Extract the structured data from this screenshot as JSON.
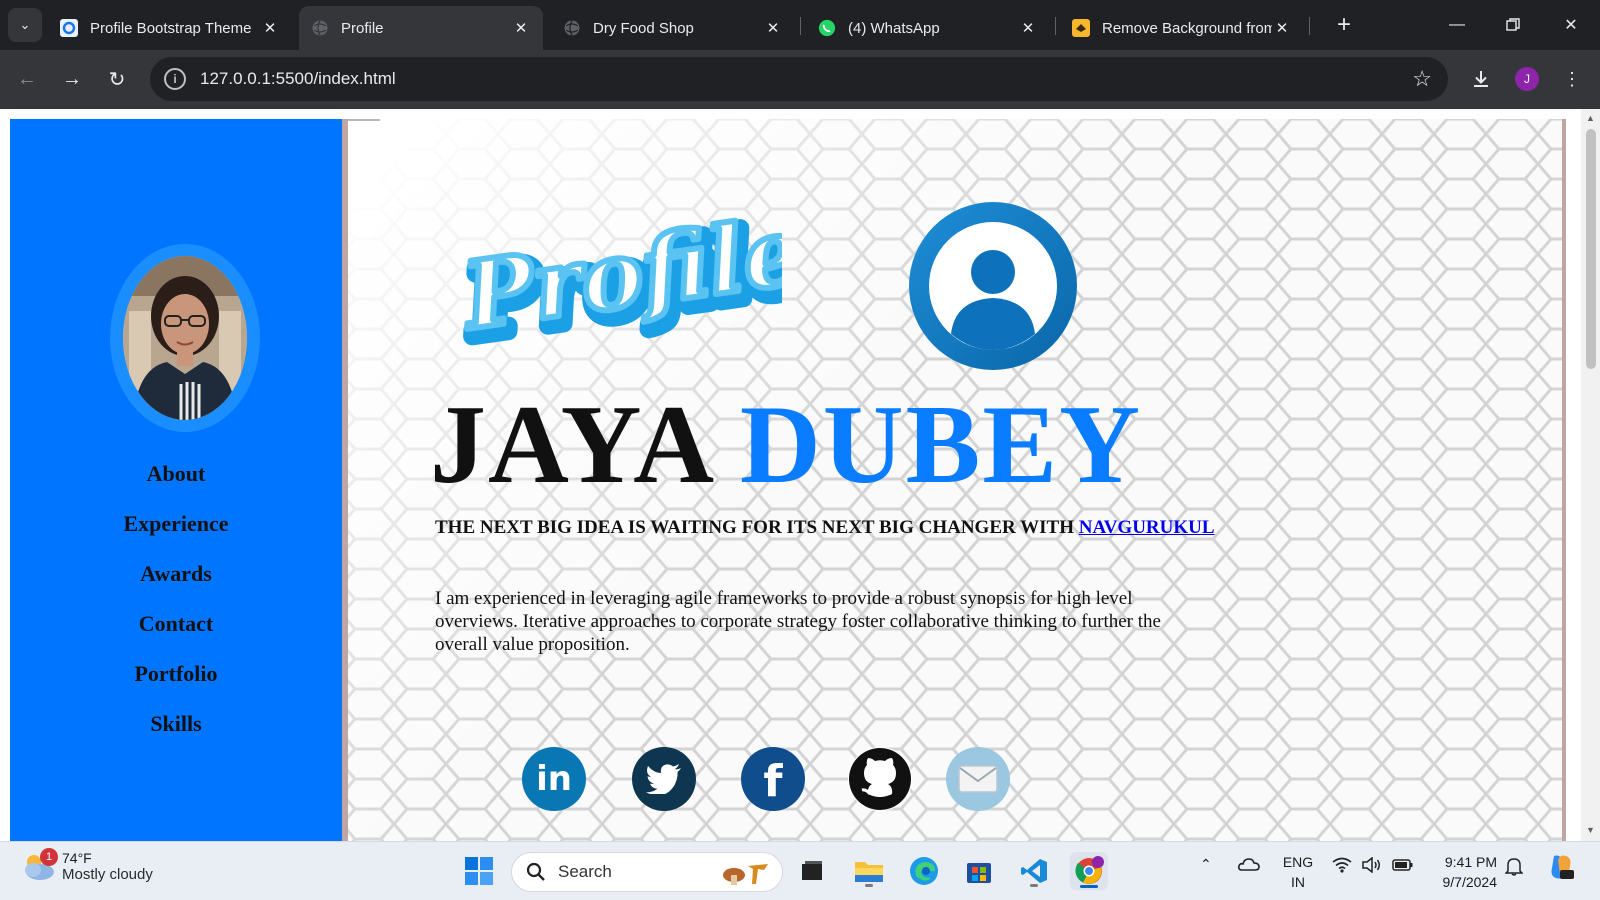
{
  "browser": {
    "tabs": [
      {
        "title": "Profile Bootstrap Theme",
        "active": false
      },
      {
        "title": "Profile",
        "active": true
      },
      {
        "title": "Dry Food Shop",
        "active": false
      },
      {
        "title": "(4) WhatsApp",
        "active": false
      },
      {
        "title": "Remove Background from",
        "active": false
      }
    ],
    "url": "127.0.0.1:5500/index.html",
    "profile_initial": "J"
  },
  "page": {
    "sidebar": {
      "nav": [
        "About",
        "Experience",
        "Awards",
        "Contact",
        "Portfolio",
        "Skills"
      ],
      "accent_color": "#0075ff"
    },
    "hero": {
      "logo_text": "Profile",
      "first_name": "JAYA",
      "last_name": "DUBEY",
      "tagline": "THE NEXT BIG IDEA IS WAITING FOR ITS NEXT BIG CHANGER WITH",
      "tagline_link": "NAVGURUKUL",
      "bio": "I am experienced in leveraging agile frameworks to provide a robust synopsis for high level overviews. Iterative approaches to corporate strategy foster collaborative thinking to further the overall value proposition."
    },
    "socials": [
      {
        "icon": "linkedin-icon",
        "label": "in"
      },
      {
        "icon": "twitter-icon"
      },
      {
        "icon": "facebook-icon",
        "label": "f"
      },
      {
        "icon": "github-icon"
      },
      {
        "icon": "email-icon"
      }
    ]
  },
  "taskbar": {
    "weather": {
      "temp": "74°F",
      "condition": "Mostly cloudy",
      "badge": "1"
    },
    "search_placeholder": "Search",
    "language": {
      "line1": "ENG",
      "line2": "IN"
    },
    "clock": {
      "time": "9:41 PM",
      "date": "9/7/2024"
    }
  }
}
